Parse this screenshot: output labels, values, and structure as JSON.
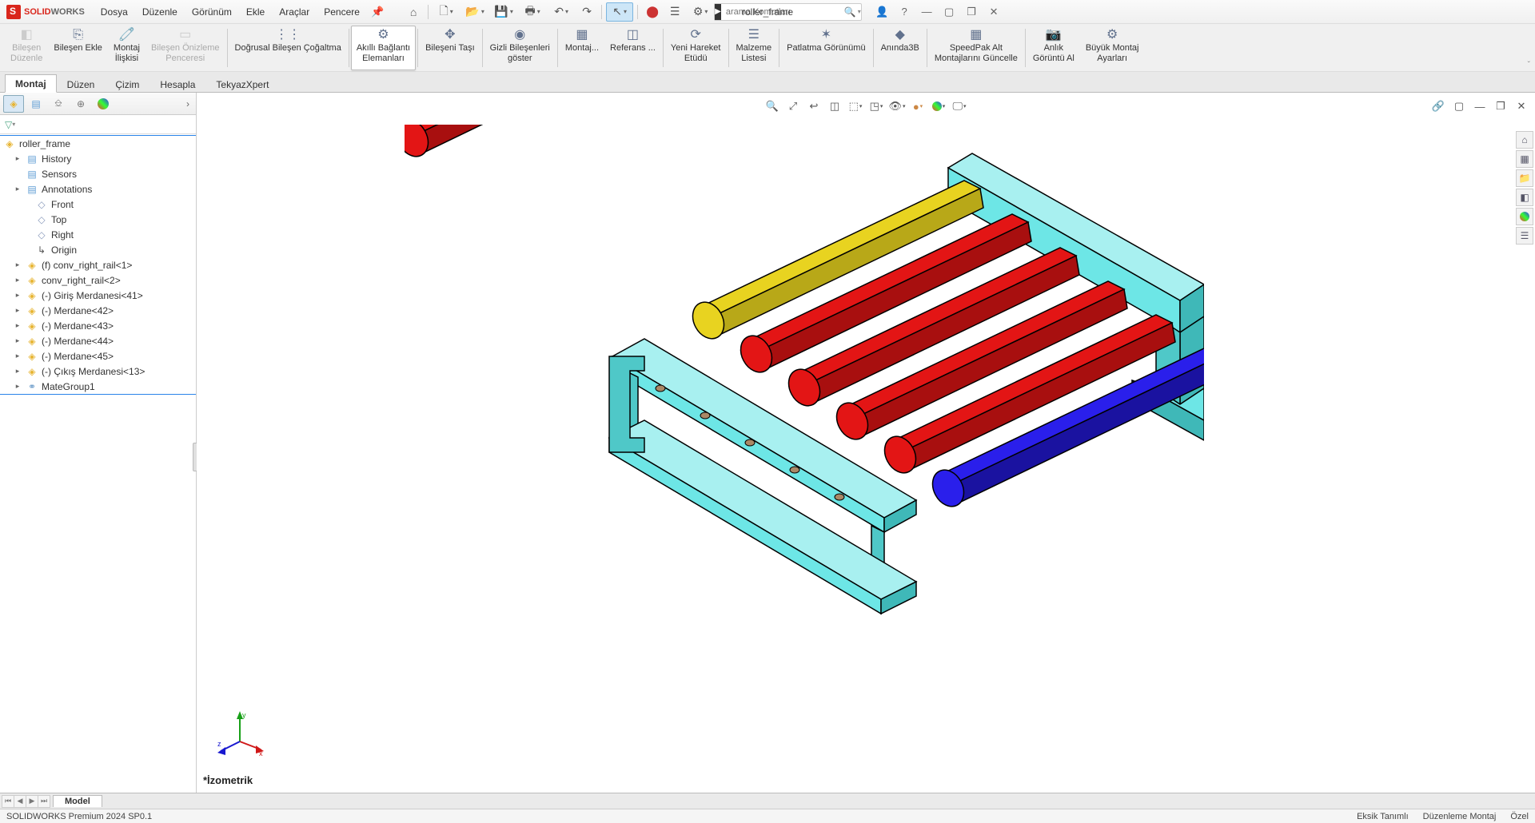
{
  "app": {
    "name_red": "SOLID",
    "name_gray": "WORKS",
    "doc_title": "roller_frame"
  },
  "menus": [
    "Dosya",
    "Düzenle",
    "Görünüm",
    "Ekle",
    "Araçlar",
    "Pencere"
  ],
  "search": {
    "placeholder": "arama Komutları"
  },
  "ribbon": [
    {
      "label": "Bileşen\nDüzenle",
      "disabled": true,
      "icon": "◧"
    },
    {
      "label": "Bileşen Ekle",
      "icon": "⎘"
    },
    {
      "label": "Montaj\nİlişkisi",
      "icon": "🧷"
    },
    {
      "label": "Bileşen Önizleme\nPenceresi",
      "disabled": true,
      "icon": "▭"
    },
    {
      "label": "Doğrusal Bileşen Çoğaltma",
      "icon": "⋮⋮"
    },
    {
      "label": "Akıllı Bağlantı\nElemanları",
      "active": true,
      "icon": "⚙"
    },
    {
      "label": "Bileşeni Taşı",
      "icon": "✥"
    },
    {
      "label": "Gizli Bileşenleri\ngöster",
      "icon": "◉"
    },
    {
      "label": "Montaj...",
      "icon": "▦"
    },
    {
      "label": "Referans ...",
      "icon": "◫"
    },
    {
      "label": "Yeni Hareket\nEtüdü",
      "icon": "⟳"
    },
    {
      "label": "Malzeme\nListesi",
      "icon": "☰"
    },
    {
      "label": "Patlatma Görünümü",
      "icon": "✶"
    },
    {
      "label": "Anında3B",
      "icon": "◆"
    },
    {
      "label": "SpeedPak Alt\nMontajlarını Güncelle",
      "icon": "▦"
    },
    {
      "label": "Anlık\nGörüntü Al",
      "icon": "📷"
    },
    {
      "label": "Büyük Montaj\nAyarları",
      "icon": "⚙"
    }
  ],
  "tabs": [
    "Montaj",
    "Düzen",
    "Çizim",
    "Hesapla",
    "TekyazXpert"
  ],
  "tree": {
    "root": "roller_frame",
    "items": [
      {
        "label": "History",
        "icon": "doc",
        "twisty": true,
        "indent": 1
      },
      {
        "label": "Sensors",
        "icon": "doc",
        "indent": 1
      },
      {
        "label": "Annotations",
        "icon": "doc",
        "twisty": true,
        "indent": 1
      },
      {
        "label": "Front",
        "icon": "plane",
        "indent": 2
      },
      {
        "label": "Top",
        "icon": "plane",
        "indent": 2
      },
      {
        "label": "Right",
        "icon": "plane",
        "indent": 2
      },
      {
        "label": "Origin",
        "icon": "origin",
        "indent": 2
      },
      {
        "label": "(f) conv_right_rail<1>",
        "icon": "part",
        "twisty": true,
        "indent": 1
      },
      {
        "label": "conv_right_rail<2>",
        "icon": "part",
        "twisty": true,
        "indent": 1
      },
      {
        "label": "(-) Giriş Merdanesi<41>",
        "icon": "part",
        "twisty": true,
        "indent": 1
      },
      {
        "label": "(-) Merdane<42>",
        "icon": "part",
        "twisty": true,
        "indent": 1
      },
      {
        "label": "(-) Merdane<43>",
        "icon": "part",
        "twisty": true,
        "indent": 1
      },
      {
        "label": "(-) Merdane<44>",
        "icon": "part",
        "twisty": true,
        "indent": 1
      },
      {
        "label": "(-) Merdane<45>",
        "icon": "part",
        "twisty": true,
        "indent": 1
      },
      {
        "label": "(-) Çıkış Merdanesi<13>",
        "icon": "part",
        "twisty": true,
        "indent": 1
      },
      {
        "label": "MateGroup1",
        "icon": "mate",
        "twisty": true,
        "indent": 1
      }
    ]
  },
  "view_label": "*İzometrik",
  "bottom_tab": "Model",
  "status": {
    "left": "SOLIDWORKS Premium 2024 SP0.1",
    "r1": "Eksik Tanımlı",
    "r2": "Düzenleme Montaj",
    "r3": "Özel"
  },
  "colors": {
    "cyan": "#6de6e6",
    "cyan_dark": "#3fb8b8",
    "red": "#e31515",
    "red_dark": "#a80f0f",
    "yellow": "#e8d320",
    "yellow_dark": "#b8a818",
    "blue": "#2a1feb",
    "blue_dark": "#1a12a0"
  },
  "triad": {
    "x": "x",
    "y": "y",
    "z": "z"
  },
  "separators": [
    4,
    5,
    6,
    7,
    8,
    10,
    11,
    12,
    13,
    14,
    15
  ]
}
